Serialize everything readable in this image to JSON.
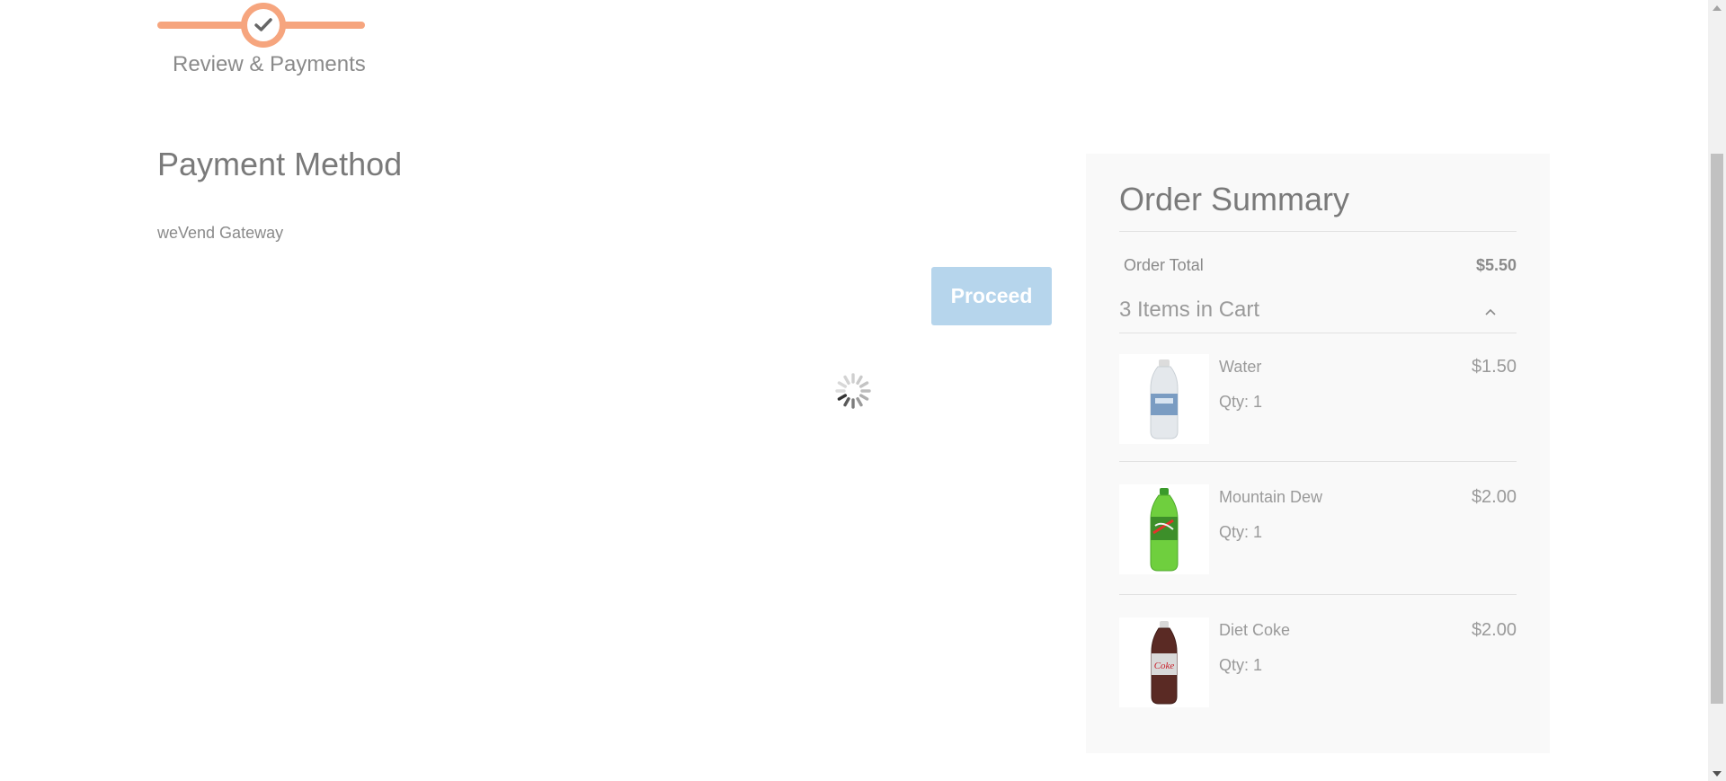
{
  "progress": {
    "step_label": "Review & Payments",
    "step_icon": "check-icon"
  },
  "payment": {
    "title": "Payment Method",
    "gateway": "weVend Gateway",
    "proceed_label": "Proceed"
  },
  "summary": {
    "title": "Order Summary",
    "total_label": "Order Total",
    "total_value": "$5.50",
    "items_label": "3 Items in Cart",
    "items": [
      {
        "name": "Water",
        "qty": "Qty: 1",
        "price": "$1.50",
        "image": "water-bottle-image"
      },
      {
        "name": "Mountain Dew",
        "qty": "Qty: 1",
        "price": "$2.00",
        "image": "mountain-dew-bottle-image"
      },
      {
        "name": "Diet Coke",
        "qty": "Qty: 1",
        "price": "$2.00",
        "image": "diet-coke-bottle-image"
      }
    ]
  },
  "colors": {
    "accent": "#f6a57e",
    "proceed_bg": "#b6d5ec",
    "summary_bg": "#f9f9f9"
  }
}
